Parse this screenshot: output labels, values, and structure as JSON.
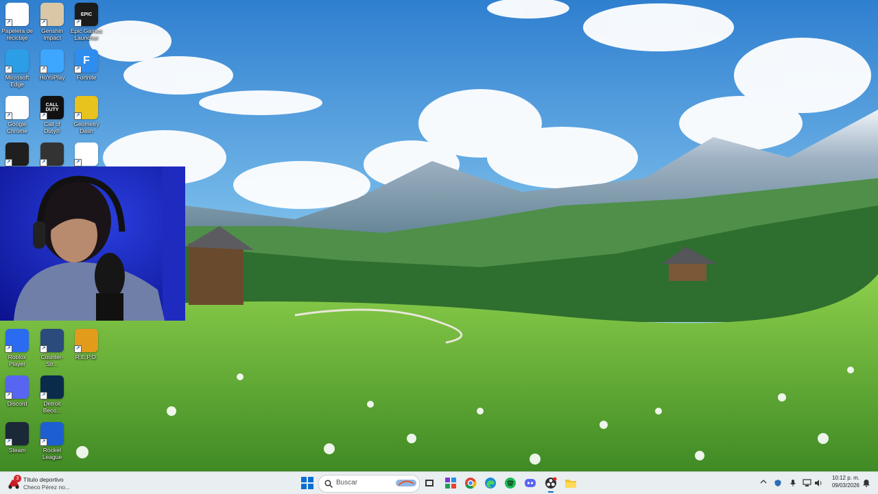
{
  "desktop_icons": [
    {
      "label": "Papelera de reciclaje",
      "icon": "recycle-bin-icon",
      "color": "#ffffff"
    },
    {
      "label": "Genshin Impact",
      "icon": "genshin-impact-icon",
      "color": "#d9c7a6"
    },
    {
      "label": "Epic Games Launcher",
      "icon": "epic-games-icon",
      "color": "#1b1b1b",
      "glyph": "EPIC"
    },
    {
      "label": "Microsoft Edge",
      "icon": "edge-icon",
      "color": "#2b9ee6"
    },
    {
      "label": "HoYoPlay",
      "icon": "hoyoplay-icon",
      "color": "#3ea6ff"
    },
    {
      "label": "Fortnite",
      "icon": "fortnite-icon",
      "color": "#2f8df0",
      "glyph": "F"
    },
    {
      "label": "Google Chrome",
      "icon": "chrome-icon",
      "color": "#ffffff"
    },
    {
      "label": "Call of Duty®",
      "icon": "call-of-duty-icon",
      "color": "#111111",
      "glyph": "CALL DUTY"
    },
    {
      "label": "Geometry Dash",
      "icon": "geometry-dash-icon",
      "color": "#e8c21d"
    },
    {
      "label": "Roblox Player",
      "icon": "roblox-icon",
      "color": "#2a6bf2"
    },
    {
      "label": "Counter-Str...",
      "icon": "counter-strike-icon",
      "color": "#2a4b7c"
    },
    {
      "label": "R.E.P.O.",
      "icon": "repo-icon",
      "color": "#e39b1c"
    },
    {
      "label": "Discord",
      "icon": "discord-icon",
      "color": "#5865f2"
    },
    {
      "label": "Detroit Beco...",
      "icon": "detroit-become-human-icon",
      "color": "#0b2b4a"
    },
    {
      "label": "Steam",
      "icon": "steam-icon",
      "color": "#1b2838"
    },
    {
      "label": "Rocket League",
      "icon": "rocket-league-icon",
      "color": "#1d5fd1"
    },
    {
      "label": "",
      "icon": "nvidia-icon",
      "color": "#1f1f1f"
    },
    {
      "label": "",
      "icon": "obs-icon",
      "color": "#333333"
    },
    {
      "label": "",
      "icon": "webcam-app-icon",
      "color": "#ffffff"
    }
  ],
  "taskbar": {
    "notification": {
      "title": "Título deportivo",
      "subtitle": "Checo Pérez no...",
      "badge": "3"
    },
    "search_placeholder": "Buscar",
    "pinned": [
      "start-icon",
      "search-icon",
      "widget-icon",
      "task-view-icon",
      "store-icon",
      "chrome-icon",
      "edge-icon",
      "spotify-icon",
      "discord-icon",
      "obs-icon",
      "file-explorer-icon"
    ],
    "clock_time": "10:12 p. m.",
    "clock_date": "09/03/2026"
  },
  "colors": {
    "accent": "#0067c0",
    "taskbar_bg": "#e9eef0"
  }
}
